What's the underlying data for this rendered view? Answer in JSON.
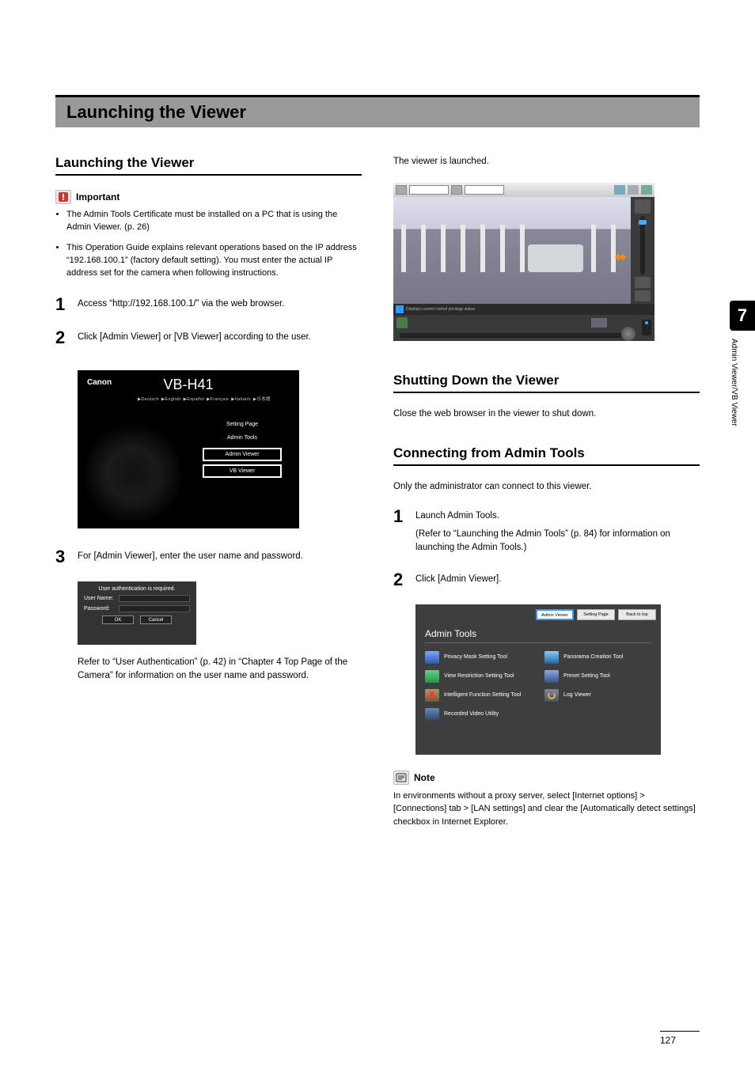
{
  "page_number": "127",
  "chapter": {
    "number": "7",
    "side_label": "Admin Viewer/VB Viewer"
  },
  "title_bar": "Launching the Viewer",
  "left": {
    "heading": "Launching the Viewer",
    "important_label": "Important",
    "important_bullets": [
      "The Admin Tools Certificate must be installed on a PC that is using the Admin Viewer. (p. 26)",
      "This Operation Guide explains relevant operations based on the IP address “192.168.100.1” (factory default setting). You must enter the actual IP address set for the camera when following instructions."
    ],
    "steps": {
      "s1": {
        "num": "1",
        "text": "Access “http://192.168.100.1/” via the web browser."
      },
      "s2": {
        "num": "2",
        "text": "Click [Admin Viewer] or [VB Viewer] according to the user."
      },
      "s3": {
        "num": "3",
        "text": "For [Admin Viewer], enter the user name and password."
      }
    },
    "footer_text": "Refer to “User Authentication” (p. 42) in “Chapter 4 Top Page of the Camera” for information on the user name and password.",
    "fig_vb": {
      "brand": "Canon",
      "model": "VB-H41",
      "langs": "▶Deutsch ▶English ▶Español ▶Français ▶Italiano ▶日本語",
      "menu": {
        "m1": "Setting Page",
        "m2": "Admin Tools",
        "m3": "Admin Viewer",
        "m4": "VB Viewer"
      }
    },
    "fig_auth": {
      "title": "User authentication is required.",
      "user": "User Name:",
      "pass": "Password:",
      "ok": "OK",
      "cancel": "Cancel"
    }
  },
  "right": {
    "launched_text": "The viewer is launched.",
    "viewer_status": "Displays current control privilege status.",
    "shutdown": {
      "heading": "Shutting Down the Viewer",
      "text": "Close the web browser in the viewer to shut down."
    },
    "connect": {
      "heading": "Connecting from Admin Tools",
      "intro": "Only the administrator can connect to this viewer.",
      "s1": {
        "num": "1",
        "text": "Launch Admin Tools.",
        "sub": "(Refer to “Launching the Admin Tools” (p. 84) for information on launching the Admin Tools.)"
      },
      "s2": {
        "num": "2",
        "text": "Click [Admin Viewer]."
      }
    },
    "fig_admin": {
      "top": {
        "b1": "Admin Viewer",
        "b2": "Setting Page",
        "b3": "Back to top"
      },
      "title": "Admin Tools",
      "tools": {
        "t1": "Privacy Mask Setting Tool",
        "t2": "Panorama Creation Tool",
        "t3": "View Restriction Setting Tool",
        "t4": "Preset Setting Tool",
        "t5": "Intelligent Function Setting Tool",
        "t6": "Log Viewer",
        "t7": "Recorded Video Utility"
      }
    },
    "note_label": "Note",
    "note_text": "In environments without a proxy server, select [Internet options] > [Connections] tab > [LAN settings] and clear the [Automatically detect settings] checkbox in Internet Explorer."
  }
}
